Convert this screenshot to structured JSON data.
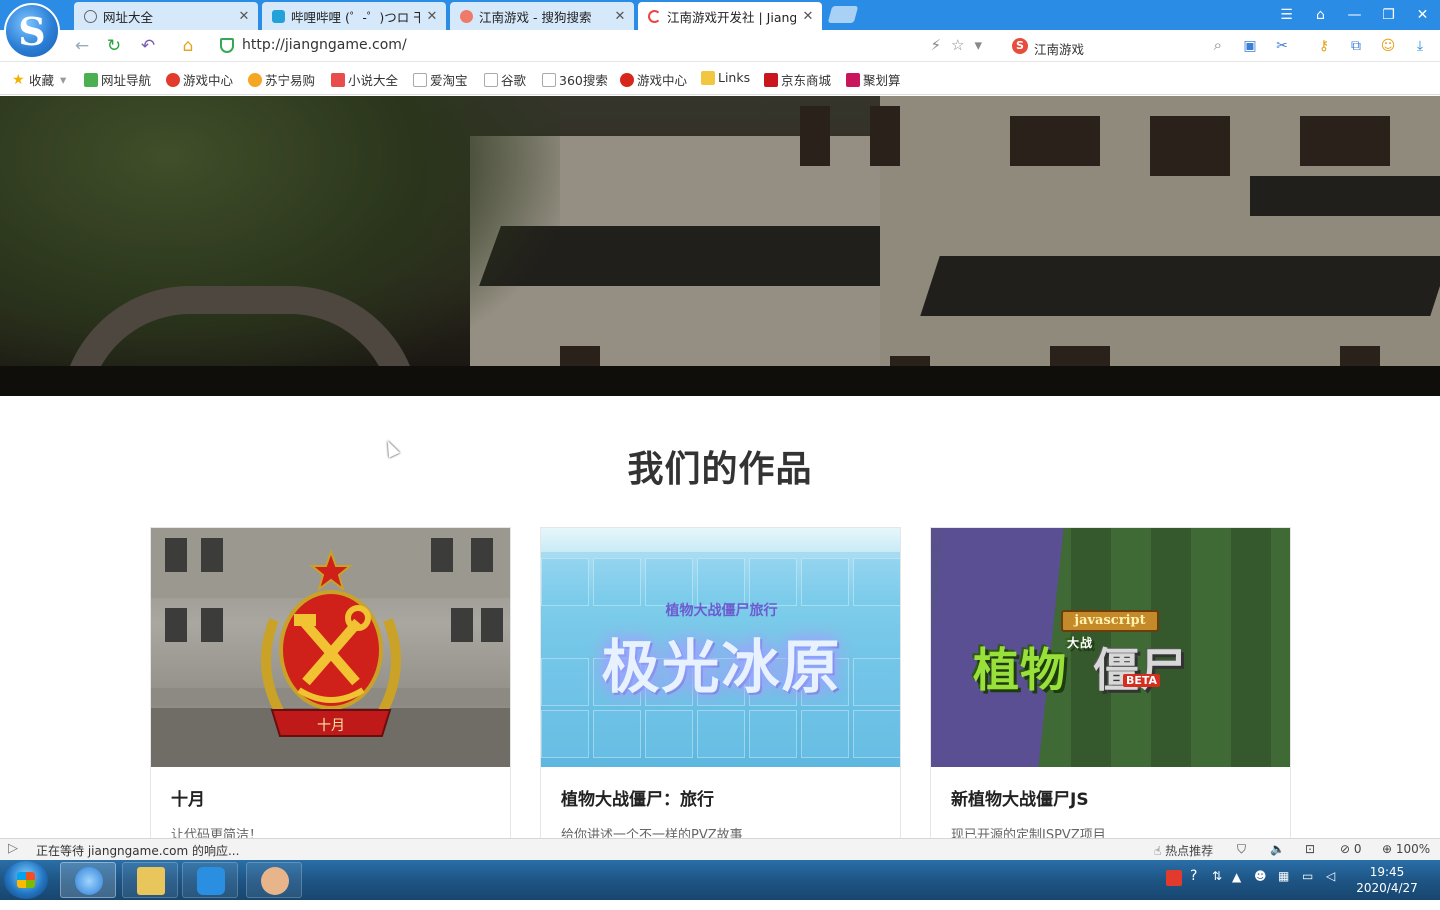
{
  "browser": {
    "tabs": [
      {
        "title": "网址大全",
        "active": false
      },
      {
        "title": "哔哩哔哩 (゜-゜)つロ 干",
        "active": false
      },
      {
        "title": "江南游戏 - 搜狗搜索",
        "active": false
      },
      {
        "title": "江南游戏开发社 | Jiang",
        "active": true
      }
    ],
    "url": "http://jiangngame.com/",
    "search_value": "江南游戏",
    "bookmarks": [
      "收藏",
      "网址导航",
      "游戏中心",
      "苏宁易购",
      "小说大全",
      "爱淘宝",
      "谷歌",
      "360搜索",
      "游戏中心",
      "Links",
      "京东商城",
      "聚划算"
    ]
  },
  "page": {
    "section_title": "我们的作品",
    "cards": [
      {
        "title": "十月",
        "desc": "让代码更简洁！",
        "image_text": "十月"
      },
      {
        "title": "植物大战僵尸：旅行",
        "desc": "给你讲述一个不一样的PVZ故事",
        "image_text": "极光冰原",
        "image_sub": "植物大战僵尸旅行"
      },
      {
        "title": "新植物大战僵尸JS",
        "desc": "现已开源的定制JSPVZ项目",
        "image_tag": "javascript",
        "image_text_plants": "植物",
        "image_text_zombie": "僵尸",
        "image_small": "大战",
        "image_badge": "BETA"
      }
    ]
  },
  "statusbar": {
    "loading": "正在等待 jiangngame.com 的响应...",
    "hot": "热点推荐",
    "blocked": "0",
    "zoom": "100%"
  },
  "taskbar": {
    "time": "19:45",
    "date": "2020/4/27"
  }
}
